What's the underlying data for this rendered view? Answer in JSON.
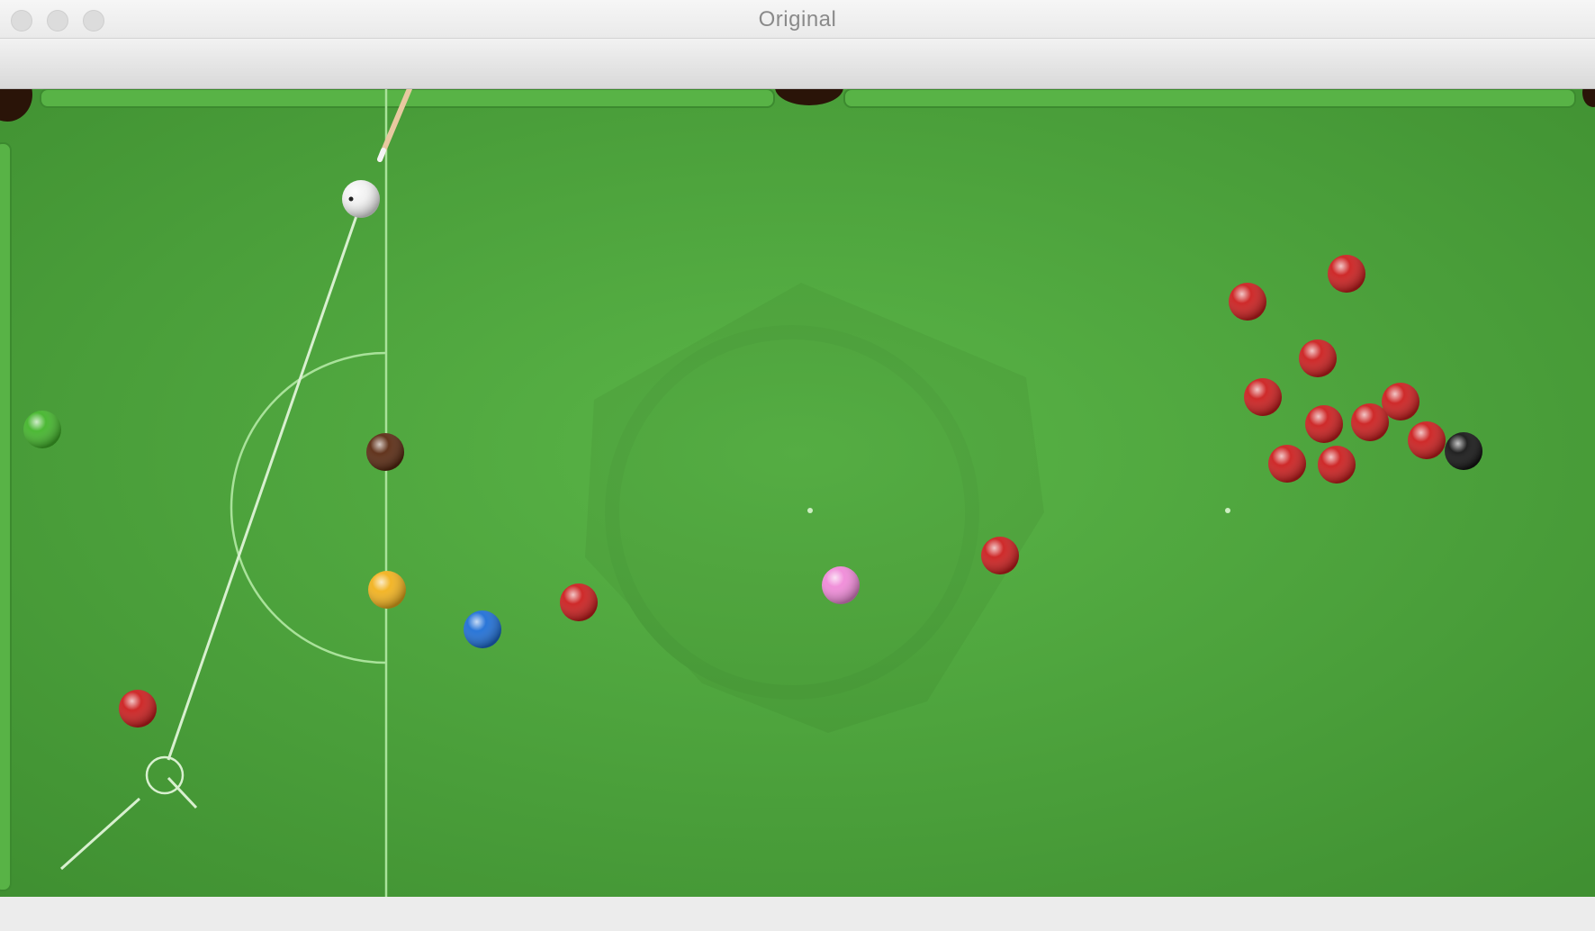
{
  "window": {
    "title": "Original"
  },
  "colors": {
    "felt": "#4fa63d",
    "felt_dark": "#3f8f31",
    "cushion": "#55ad43",
    "baulk_line": "#a9e29a",
    "aim_line": "#d8f0cf",
    "red": "#cc1f1f",
    "yellow": "#f2b21e",
    "green": "#43b52b",
    "brown": "#5a2a12",
    "blue": "#1f6fd6",
    "pink": "#f08ad8",
    "black": "#161616",
    "white": "#f2f2f2",
    "cue": "#e8c9a0"
  },
  "icons": {
    "close": "window-close-icon",
    "minimize": "window-minimize-icon",
    "zoom": "window-zoom-icon"
  },
  "balls": [
    {
      "id": "cue-ball",
      "color": "white"
    },
    {
      "id": "green-ball",
      "color": "green"
    },
    {
      "id": "brown-ball",
      "color": "brown"
    },
    {
      "id": "yellow-ball",
      "color": "yellow"
    },
    {
      "id": "blue-ball",
      "color": "blue"
    },
    {
      "id": "pink-ball",
      "color": "pink"
    },
    {
      "id": "black-ball",
      "color": "black"
    },
    {
      "id": "red-ball-1",
      "color": "red"
    },
    {
      "id": "red-ball-2",
      "color": "red"
    },
    {
      "id": "red-ball-3",
      "color": "red"
    },
    {
      "id": "red-ball-4",
      "color": "red"
    },
    {
      "id": "red-ball-5",
      "color": "red"
    },
    {
      "id": "red-ball-6",
      "color": "red"
    },
    {
      "id": "red-ball-7",
      "color": "red"
    },
    {
      "id": "red-ball-8",
      "color": "red"
    },
    {
      "id": "red-ball-9",
      "color": "red"
    },
    {
      "id": "red-ball-10",
      "color": "red"
    },
    {
      "id": "red-ball-11",
      "color": "red"
    },
    {
      "id": "red-ball-12",
      "color": "red"
    },
    {
      "id": "red-ball-13",
      "color": "red"
    },
    {
      "id": "red-ball-14",
      "color": "red"
    }
  ]
}
